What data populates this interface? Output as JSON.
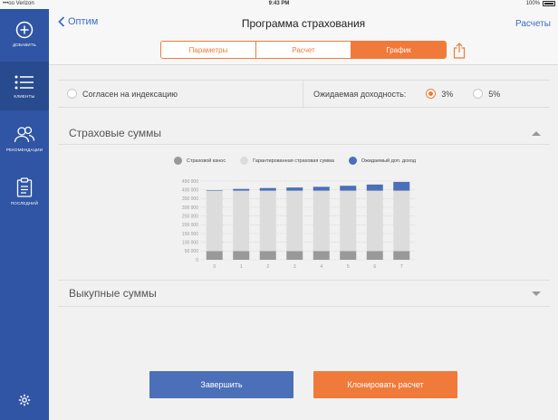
{
  "status": {
    "carrier": "•••oo Verizon",
    "time": "9:43 PM",
    "battery": "100%"
  },
  "sidebar": {
    "items": [
      {
        "label": "ДОБАВИТЬ",
        "icon": "plus-circle-icon"
      },
      {
        "label": "КЛИЕНТЫ",
        "icon": "list-icon"
      },
      {
        "label": "РЕКОМЕНДАЦИИ",
        "icon": "people-icon"
      },
      {
        "label": "ПОСЛЕДНИЙ",
        "icon": "clipboard-icon"
      }
    ],
    "settings_icon": "gear-icon"
  },
  "nav": {
    "back_label": "Оптим",
    "title": "Программа страхования",
    "right_label": "Расчеты",
    "tabs": [
      "Параметры",
      "Расчет",
      "График"
    ],
    "active_tab": "График"
  },
  "options": {
    "indexation_label": "Согласен на индексацию",
    "indexation_checked": false,
    "yield_label": "Ожидаемая доходность:",
    "yield_options": [
      "3%",
      "5%"
    ],
    "yield_selected": "3%"
  },
  "sections": {
    "insurance_title": "Страховые суммы",
    "surrender_title": "Выкупные суммы"
  },
  "colors": {
    "accent": "#f07a3a",
    "brand": "#2f55a4",
    "base": "#999999",
    "guaranteed": "#dcdcdc",
    "expected": "#4b6fb8"
  },
  "chart_data": {
    "type": "bar",
    "stacked": true,
    "categories": [
      "0",
      "1",
      "2",
      "3",
      "4",
      "5",
      "6",
      "7"
    ],
    "series": [
      {
        "name": "Страховой взнос",
        "color": "#999999",
        "values": [
          50000,
          50000,
          50000,
          50000,
          50000,
          50000,
          50000,
          50000
        ]
      },
      {
        "name": "Гарантированная страховая сумма",
        "color": "#dcdcdc",
        "values": [
          345000,
          345000,
          345000,
          345000,
          345000,
          345000,
          345000,
          345000
        ]
      },
      {
        "name": "Ожидаемый доп. доход",
        "color": "#4b6fb8",
        "values": [
          3000,
          10000,
          15000,
          18000,
          22000,
          28000,
          35000,
          50000
        ]
      }
    ],
    "yticks": [
      "0",
      "50 000",
      "100 000",
      "150 000",
      "200 000",
      "250 000",
      "300 000",
      "350 000",
      "400 000",
      "450 000"
    ],
    "ylim": [
      0,
      450000
    ],
    "grid": true
  },
  "buttons": {
    "finish": "Завершить",
    "clone": "Клонировать расчет"
  }
}
